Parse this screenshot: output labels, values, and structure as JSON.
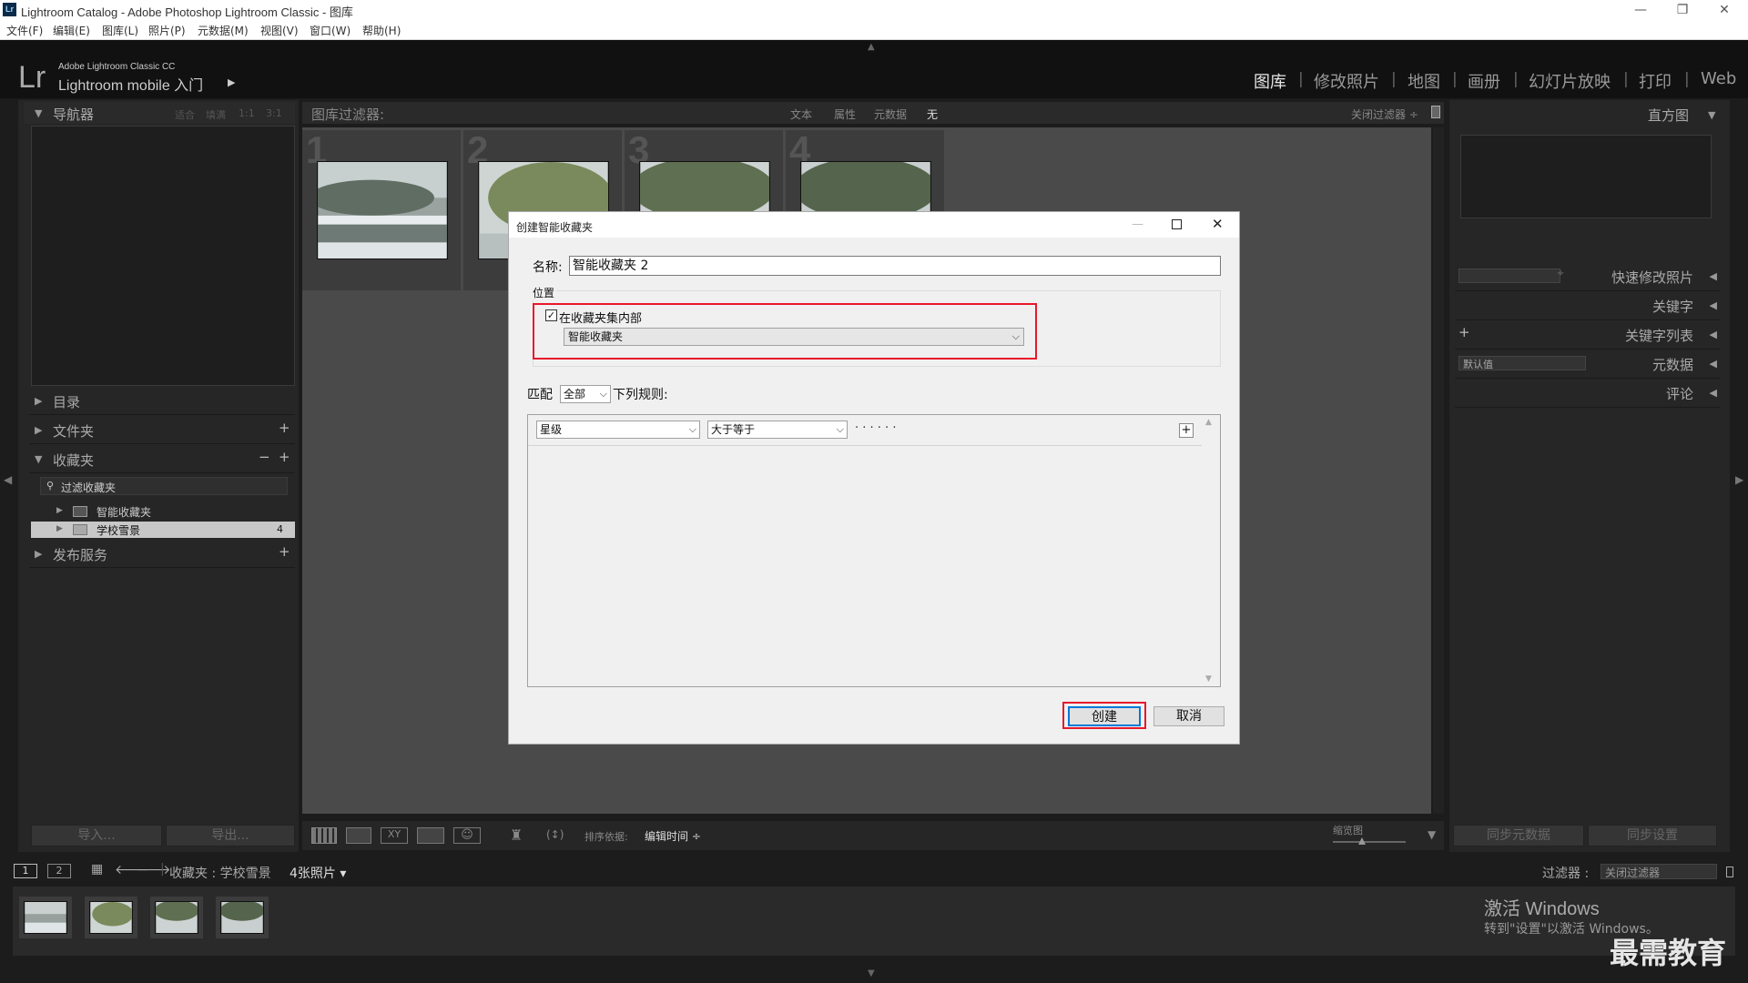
{
  "window": {
    "title": "Lightroom Catalog - Adobe Photoshop Lightroom Classic - 图库",
    "minimize": "—",
    "restore": "❐",
    "close": "✕"
  },
  "menu": [
    "文件(F)",
    "编辑(E)",
    "图库(L)",
    "照片(P)",
    "元数据(M)",
    "视图(V)",
    "窗口(W)",
    "帮助(H)"
  ],
  "identity": {
    "logo": "Lr",
    "product": "Adobe Lightroom Classic CC",
    "mobile": "Lightroom mobile 入门"
  },
  "modules": [
    "图库",
    "修改照片",
    "地图",
    "画册",
    "幻灯片放映",
    "打印",
    "Web"
  ],
  "navigator": {
    "title": "导航器",
    "zoom": [
      "适合",
      "填满",
      "1:1",
      "3:1"
    ]
  },
  "left_panels": {
    "catalog": "目录",
    "folders": "文件夹",
    "collections": "收藏夹",
    "filter_collections": "过滤收藏夹",
    "smart_collections": "智能收藏夹",
    "school_snow": "学校雪景",
    "school_snow_count": "4",
    "publish": "发布服务",
    "plus": "+",
    "minus": "−"
  },
  "filterbar": {
    "label": "图库过滤器:",
    "text": "文本",
    "attribute": "属性",
    "metadata": "元数据",
    "none": "无",
    "close_filter": "关闭过滤器 ÷"
  },
  "grid": {
    "numbers": [
      "1",
      "2",
      "3",
      "4"
    ]
  },
  "right_panels": {
    "histogram": "直方图",
    "quick_develop": "快速修改照片",
    "keywording": "关键字",
    "keyword_list": "关键字列表",
    "metadata": "元数据",
    "metadata_default": "默认值",
    "comments": "评论"
  },
  "dialog": {
    "title": "创建智能收藏夹",
    "name_label": "名称:",
    "name_value": "智能收藏夹 2",
    "location_label": "位置",
    "inside_label": "在收藏夹集内部",
    "collection_set": "智能收藏夹",
    "match_label": "匹配",
    "match_value": "全部",
    "match_suffix": "下列规则:",
    "rule_field": "星级",
    "rule_op": "大于等于",
    "rule_value": "· · · · · ·",
    "add_rule": "+",
    "create": "创建",
    "cancel": "取消"
  },
  "toolbar": {
    "sort_label": "排序依据:",
    "sort_value": "编辑时间 ÷",
    "thumb_label": "缩览图"
  },
  "left_buttons": {
    "import": "导入...",
    "export": "导出..."
  },
  "right_buttons": {
    "sync_meta": "同步元数据",
    "sync_settings": "同步设置"
  },
  "filmstrip": {
    "views": [
      "1",
      "2"
    ],
    "source": "收藏夹 : 学校雪景",
    "count": "4张照片 ▾",
    "filter_label": "过滤器 :",
    "filter_value": "关闭过滤器"
  },
  "watermark": {
    "activate": "激活 Windows",
    "activate_sub": "转到\"设置\"以激活 Windows。",
    "brand": "最需教育"
  }
}
